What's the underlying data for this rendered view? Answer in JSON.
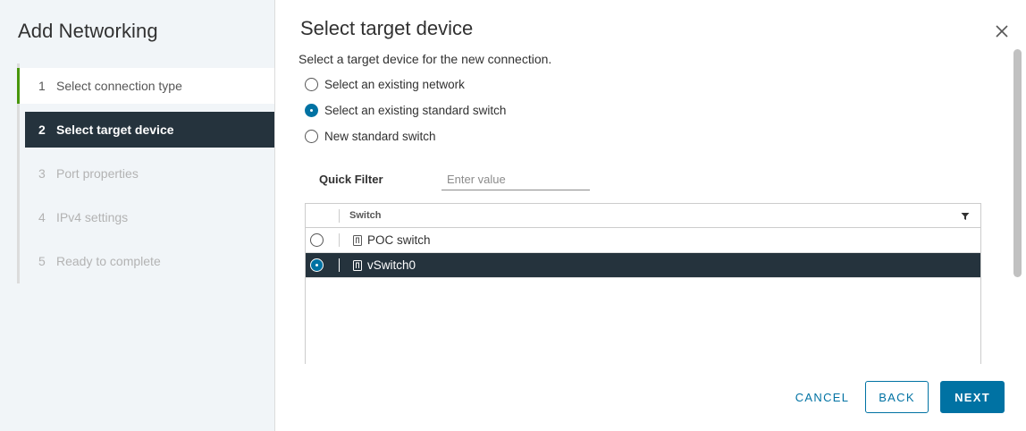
{
  "wizard": {
    "title": "Add Networking",
    "steps": [
      {
        "num": "1",
        "label": "Select connection type",
        "state": "done"
      },
      {
        "num": "2",
        "label": "Select target device",
        "state": "active"
      },
      {
        "num": "3",
        "label": "Port properties",
        "state": "pending"
      },
      {
        "num": "4",
        "label": "IPv4 settings",
        "state": "pending"
      },
      {
        "num": "5",
        "label": "Ready to complete",
        "state": "pending"
      }
    ]
  },
  "page": {
    "title": "Select target device",
    "subtitle": "Select a target device for the new connection."
  },
  "options": [
    {
      "label": "Select an existing network",
      "checked": false
    },
    {
      "label": "Select an existing standard switch",
      "checked": true
    },
    {
      "label": "New standard switch",
      "checked": false
    }
  ],
  "filter": {
    "label": "Quick Filter",
    "placeholder": "Enter value"
  },
  "grid": {
    "column_header": "Switch",
    "rows": [
      {
        "name": "POC switch",
        "selected": false
      },
      {
        "name": "vSwitch0",
        "selected": true
      }
    ]
  },
  "footer": {
    "cancel_label": "CANCEL",
    "back_label": "BACK",
    "next_label": "NEXT"
  },
  "colors": {
    "accent": "#0072a3",
    "selected_bg": "#25333d",
    "done_marker": "#48960c"
  },
  "icons": {
    "close": "close-icon",
    "filter": "filter-icon",
    "switch": "switch-icon"
  }
}
